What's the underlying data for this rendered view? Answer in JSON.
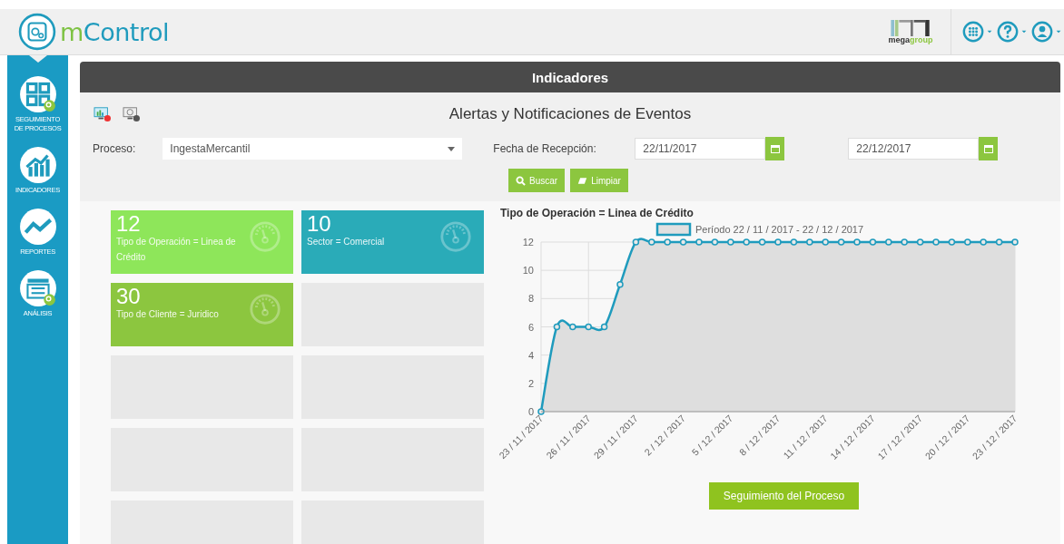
{
  "header": {
    "app_name": {
      "prefix": "m",
      "rest": "Control"
    },
    "partner": {
      "prefix": "mega",
      "rest": "group"
    }
  },
  "sidebar": {
    "items": [
      {
        "label": "SEGUIMIENTO DE PROCESOS",
        "kind": "tiles"
      },
      {
        "label": "INDICADORES",
        "kind": "growth"
      },
      {
        "label": "REPORTES",
        "kind": "trend"
      },
      {
        "label": "ANÁLISIS",
        "kind": "table"
      }
    ]
  },
  "panel": {
    "title": "Indicadores",
    "heading": "Alertas y Notificaciones de Eventos",
    "filters": {
      "process_label": "Proceso:",
      "process_value": "IngestaMercantil",
      "date_label": "Fecha de Recepción:",
      "date_from": "22/11/2017",
      "date_to": "22/12/2017"
    },
    "buttons": [
      {
        "label": "Buscar",
        "kind": "search"
      },
      {
        "label": "Limpiar",
        "kind": "eraser"
      }
    ]
  },
  "tiles": [
    {
      "kind": "indicator",
      "count": "12",
      "label": "Tipo de Operación = Linea de Crédito",
      "color": "#8ee65a"
    },
    {
      "kind": "indicator",
      "count": "10",
      "label": "Sector = Comercial",
      "color": "#2aabb8"
    },
    {
      "kind": "indicator",
      "count": "30",
      "label": "Tipo de Cliente = Juridico",
      "color": "#8cc63f"
    },
    {
      "kind": "empty"
    },
    {
      "kind": "empty"
    },
    {
      "kind": "empty"
    },
    {
      "kind": "empty"
    },
    {
      "kind": "empty"
    },
    {
      "kind": "empty"
    },
    {
      "kind": "empty"
    }
  ],
  "chart": {
    "chart_data": {
      "type": "line",
      "title": "Tipo de Operación = Linea de Crédito",
      "grid": true,
      "categories": [
        "23 / 11 / 2017",
        null,
        null,
        "26 / 11 / 2017",
        null,
        null,
        "29 / 11 / 2017",
        null,
        null,
        "2 / 12 / 2017",
        null,
        null,
        "5 / 12 / 2017",
        null,
        null,
        "8 / 12 / 2017",
        null,
        null,
        "11 / 12 / 2017",
        null,
        null,
        "14 / 12 / 2017",
        null,
        null,
        "17 / 12 / 2017",
        null,
        null,
        "20 / 12 / 2017",
        null,
        null,
        "23 / 12 / 2017"
      ],
      "series": [
        {
          "name": "Período 22 / 11 / 2017 - 22 / 12 / 2017",
          "color": "#1f9bbd",
          "marker": "circle",
          "values": [
            0,
            6,
            6,
            6,
            6,
            9,
            12,
            12,
            12,
            12,
            12,
            12,
            12,
            12,
            12,
            12,
            12,
            12,
            12,
            12,
            12,
            12,
            12,
            12,
            12,
            12,
            12,
            12,
            12,
            12,
            12
          ]
        }
      ],
      "ylim": [
        0,
        12
      ],
      "yticks": [
        0,
        2,
        4,
        6,
        8,
        10,
        12
      ]
    },
    "button": "Seguimiento del Proceso"
  }
}
